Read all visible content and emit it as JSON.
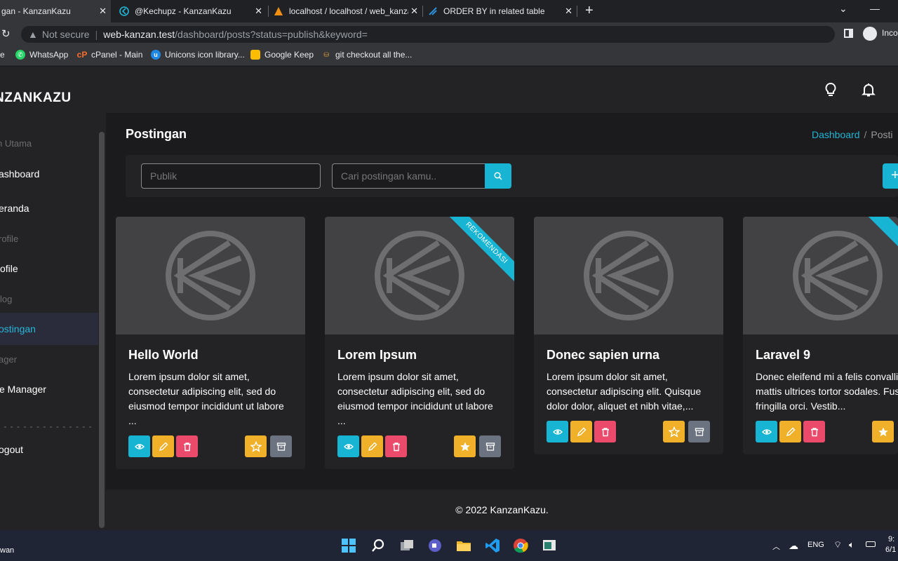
{
  "browser": {
    "tabs": [
      {
        "title": "gan - KanzanKazu",
        "active": true
      },
      {
        "title": "@Kechupz - KanzanKazu",
        "active": false
      },
      {
        "title": "localhost / localhost / web_kanza",
        "active": false
      },
      {
        "title": "ORDER BY in related table",
        "active": false
      }
    ],
    "not_secure": "Not secure",
    "url_host": "web-kanzan.test",
    "url_path": "/dashboard/posts?status=publish&keyword=",
    "profile": "Incog",
    "bookmarks": [
      {
        "label": "e"
      },
      {
        "label": "WhatsApp"
      },
      {
        "label": "cPanel - Main"
      },
      {
        "label": "Unicons icon library..."
      },
      {
        "label": "Google Keep"
      },
      {
        "label": "git checkout all the..."
      }
    ]
  },
  "sidebar": {
    "brand": "NZANKAZU",
    "sections": [
      {
        "heading": "n Utama"
      },
      {
        "item": "ashboard"
      },
      {
        "item": "eranda"
      },
      {
        "heading": "rofile"
      },
      {
        "item": "ofile"
      },
      {
        "heading": "log"
      },
      {
        "item": "ostingan",
        "active": true
      },
      {
        "heading": "ager"
      },
      {
        "item": "e Manager"
      }
    ],
    "divider": "- - - - - - - - - - - - - - -",
    "logout": "ogout"
  },
  "page": {
    "title": "Postingan",
    "breadcrumb_link": "Dashboard",
    "breadcrumb_sep": "/",
    "breadcrumb_current": "Posti",
    "filter_value": "Publik",
    "search_placeholder": "Cari postingan kamu..",
    "add_label": "+"
  },
  "posts": [
    {
      "title": "Hello World",
      "excerpt": "Lorem ipsum dolor sit amet, consectetur adipiscing elit, sed do eiusmod tempor incididunt ut labore ...",
      "recommended": false,
      "starred": false
    },
    {
      "title": "Lorem Ipsum",
      "excerpt": "Lorem ipsum dolor sit amet, consectetur adipiscing elit, sed do eiusmod tempor incididunt ut labore ...",
      "recommended": true,
      "starred": true
    },
    {
      "title": "Donec sapien urna",
      "excerpt": "Lorem ipsum dolor sit amet, consectetur adipiscing elit. Quisque dolor dolor, aliquet et nibh vitae,...",
      "recommended": false,
      "starred": false
    },
    {
      "title": "Laravel 9",
      "excerpt": "Donec eleifend mi a felis convallis mattis ultrices tortor sodales. Fusce in fringilla orci. Vestib...",
      "recommended": true,
      "starred": true
    }
  ],
  "ribbon_label": "REKOMENDASI",
  "ribbon_label_clipped": "REK",
  "footer": "© 2022 KanzanKazu.",
  "taskbar": {
    "user_line1": "",
    "user_line2": "wan",
    "lang": "ENG",
    "time": "9:",
    "date": "6/1"
  }
}
